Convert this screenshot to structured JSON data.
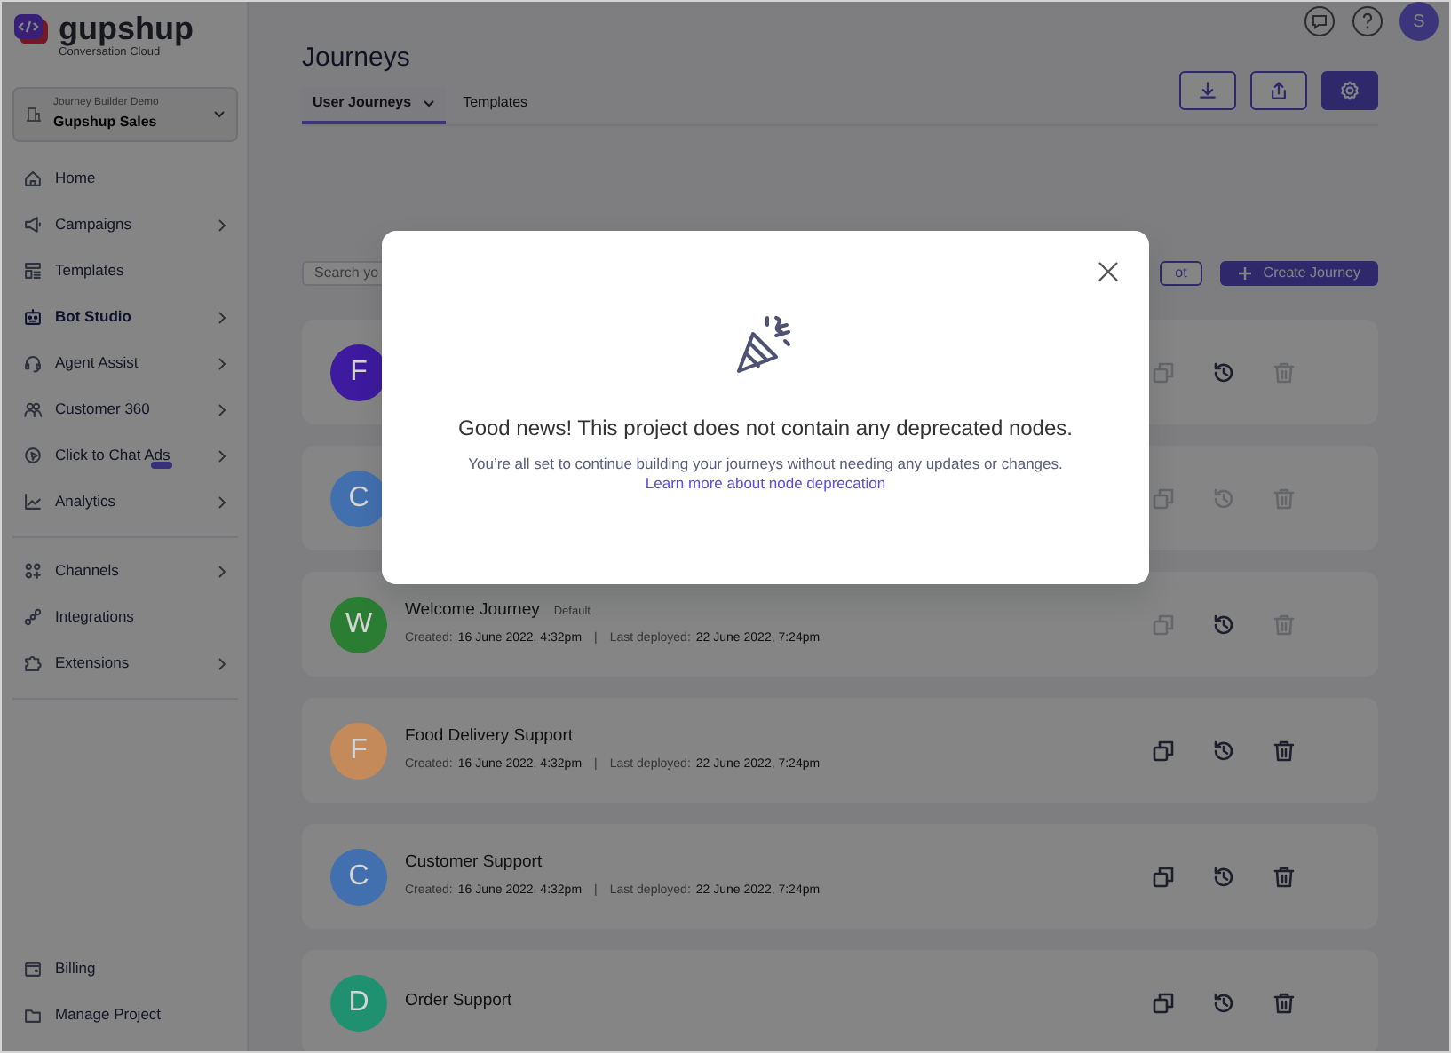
{
  "brand": {
    "name": "gupshup",
    "tagline": "Conversation Cloud"
  },
  "project_selector": {
    "label": "Journey Builder Demo",
    "value": "Gupshup Sales"
  },
  "sidebar": {
    "groups": [
      [
        {
          "kind": "home",
          "label": "Home",
          "submenu": false,
          "selected": false,
          "badge": false
        },
        {
          "kind": "megaphone",
          "label": "Campaigns",
          "submenu": true,
          "selected": false,
          "badge": false
        },
        {
          "kind": "template",
          "label": "Templates",
          "submenu": false,
          "selected": false,
          "badge": false
        },
        {
          "kind": "robot",
          "label": "Bot Studio",
          "submenu": true,
          "selected": true,
          "badge": false
        },
        {
          "kind": "headset",
          "label": "Agent Assist",
          "submenu": true,
          "selected": false,
          "badge": false
        },
        {
          "kind": "people",
          "label": "Customer 360",
          "submenu": true,
          "selected": false,
          "badge": false
        },
        {
          "kind": "ads",
          "label": "Click to Chat Ads",
          "submenu": true,
          "selected": false,
          "badge": true
        },
        {
          "kind": "chart",
          "label": "Analytics",
          "submenu": true,
          "selected": false,
          "badge": false
        }
      ],
      [
        {
          "kind": "channels",
          "label": "Channels",
          "submenu": true,
          "selected": false,
          "badge": false
        },
        {
          "kind": "link",
          "label": "Integrations",
          "submenu": false,
          "selected": false,
          "badge": false
        },
        {
          "kind": "puzzle",
          "label": "Extensions",
          "submenu": true,
          "selected": false,
          "badge": false
        }
      ]
    ],
    "bottom_items": [
      {
        "kind": "wallet",
        "label": "Billing",
        "selected": false
      },
      {
        "kind": "folder",
        "label": "Manage Project",
        "selected": false
      }
    ]
  },
  "user": {
    "initial": "S"
  },
  "page_title": "Journeys",
  "tabs": [
    {
      "label": "User Journeys",
      "selected": true,
      "menu": true
    },
    {
      "label": "Templates",
      "selected": false,
      "menu": false
    }
  ],
  "toolbar": [
    {
      "kind": "download",
      "primary": false
    },
    {
      "kind": "upload",
      "primary": false
    },
    {
      "kind": "settings",
      "primary": true
    }
  ],
  "search": {
    "placeholder": "Search yo"
  },
  "secondary_button": {
    "label": "ot"
  },
  "create_button": {
    "label": "Create Journey"
  },
  "journeys": [
    {
      "initial": "F",
      "color": "#3d1a9e",
      "actions": [
        {
          "kind": "copy",
          "disabled": true
        },
        {
          "kind": "history",
          "disabled": false
        },
        {
          "kind": "delete",
          "disabled": true
        }
      ]
    },
    {
      "initial": "C",
      "color": "#426fae",
      "actions": [
        {
          "kind": "copy",
          "disabled": true
        },
        {
          "kind": "history",
          "disabled": true
        },
        {
          "kind": "delete",
          "disabled": true
        }
      ]
    },
    {
      "initial": "W",
      "color": "#2b7d33",
      "name": "Welcome Journey",
      "tag": "Default",
      "created_label": "Created:",
      "created": "16 June 2022, 4:32pm",
      "separator": "|",
      "deployed_label": "Last deployed:",
      "deployed": "22 June 2022, 7:24pm",
      "actions": [
        {
          "kind": "copy",
          "disabled": true
        },
        {
          "kind": "history",
          "disabled": false
        },
        {
          "kind": "delete",
          "disabled": true
        }
      ]
    },
    {
      "initial": "F",
      "color": "#c48a5a",
      "name": "Food Delivery Support",
      "created_label": "Created:",
      "created": "16 June 2022, 4:32pm",
      "separator": "|",
      "deployed_label": "Last deployed:",
      "deployed": "22 June 2022, 7:24pm",
      "actions": [
        {
          "kind": "copy",
          "disabled": false
        },
        {
          "kind": "history",
          "disabled": false
        },
        {
          "kind": "delete",
          "disabled": false
        }
      ]
    },
    {
      "initial": "C",
      "color": "#426fae",
      "name": "Customer Support",
      "created_label": "Created:",
      "created": "16 June 2022, 4:32pm",
      "separator": "|",
      "deployed_label": "Last deployed:",
      "deployed": "22 June 2022, 7:24pm",
      "actions": [
        {
          "kind": "copy",
          "disabled": false
        },
        {
          "kind": "history",
          "disabled": false
        },
        {
          "kind": "delete",
          "disabled": false
        }
      ]
    },
    {
      "initial": "D",
      "color": "#1f9070",
      "name": "Order Support",
      "actions": [
        {
          "kind": "copy",
          "disabled": false
        },
        {
          "kind": "history",
          "disabled": false
        },
        {
          "kind": "delete",
          "disabled": false
        }
      ]
    }
  ],
  "modal": {
    "title": "Good news! This project does not contain any deprecated nodes.",
    "body": "You’re all set to continue building your journeys without needing any updates or changes.",
    "link": "Learn more about node deprecation"
  }
}
